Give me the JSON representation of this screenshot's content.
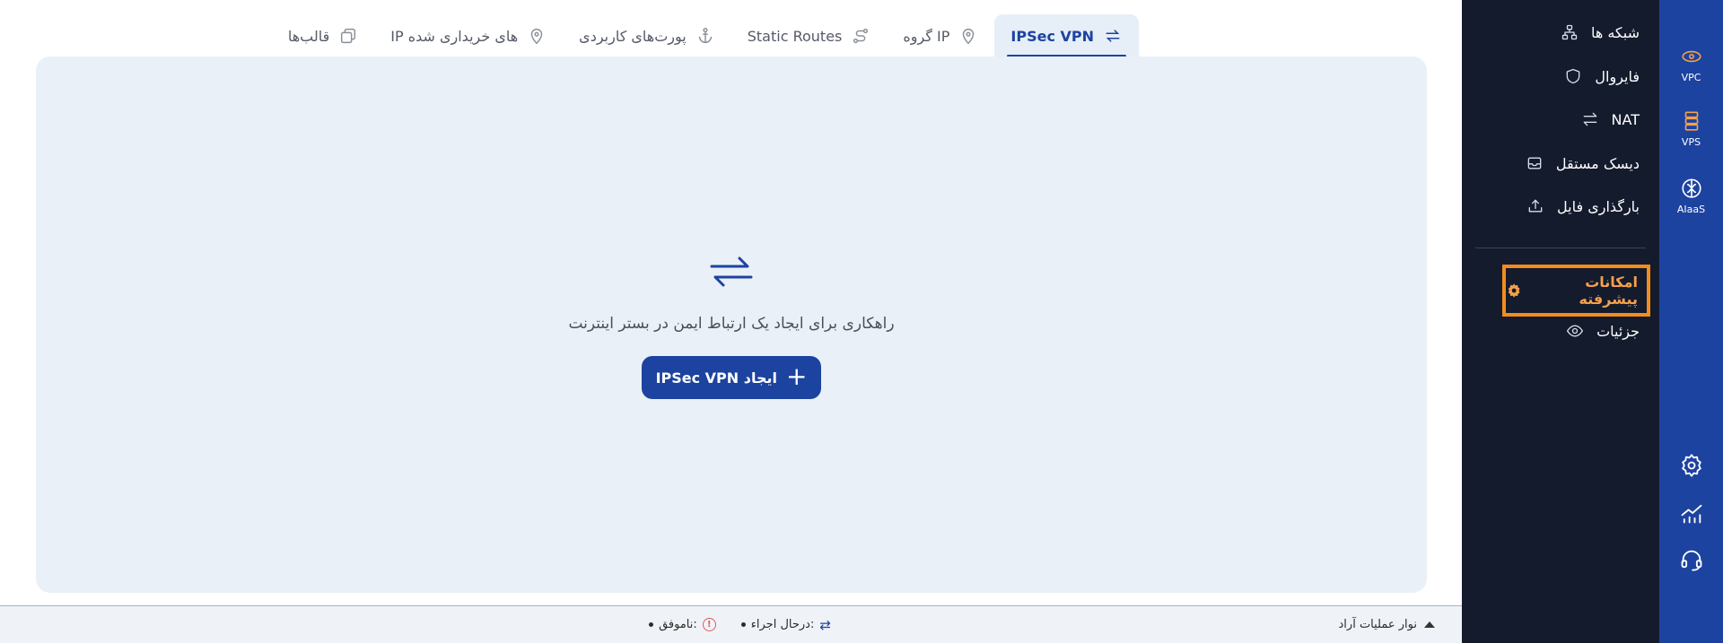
{
  "tabs": [
    {
      "label": "IPSec VPN",
      "icon": "ipsec-exchange-icon",
      "active": true
    },
    {
      "label": "گروه IP",
      "icon": "location-pin-icon",
      "active": false
    },
    {
      "label": "Static Routes",
      "icon": "route-icon",
      "active": false
    },
    {
      "label": "پورت‌های کاربردی",
      "icon": "anchor-icon",
      "active": false
    },
    {
      "label": "IP های خریداری شده",
      "icon": "location-pin-icon",
      "active": false
    },
    {
      "label": "قالب‌ها",
      "icon": "templates-icon",
      "active": false
    }
  ],
  "empty_state": {
    "icon": "ipsec-exchange-icon",
    "description": "راهکاری برای ایجاد یک ارتباط ایمن در بستر اینترنت",
    "create_button_label": "ایجاد IPSec VPN"
  },
  "status_bar": {
    "toggle_label": "نوار عملیات آراد",
    "running_label": "درحال اجراء:",
    "failed_label": "ناموفق:"
  },
  "side_menu": {
    "items": [
      {
        "label": "شبکه ها",
        "icon": "network-icon"
      },
      {
        "label": "فایروال",
        "icon": "shield-icon"
      },
      {
        "label": "NAT",
        "icon": "arrows-swap-icon"
      },
      {
        "label": "دیسک مستقل",
        "icon": "disk-icon"
      },
      {
        "label": "بارگذاری فایل",
        "icon": "upload-icon"
      }
    ],
    "advanced_label": "امکانات پیشرفته",
    "details_label": "جزئیات"
  },
  "strip": {
    "items": [
      {
        "label": "VPC",
        "icon": "vpc-icon"
      },
      {
        "label": "VPS",
        "icon": "server-icon"
      },
      {
        "label": "AIaaS",
        "icon": "brain-icon"
      }
    ]
  },
  "colors": {
    "primary": "#1d43a0",
    "sidebar_dark": "#141b2d",
    "highlight": "#f28c1c",
    "panel_bg": "#e9f0f7"
  }
}
